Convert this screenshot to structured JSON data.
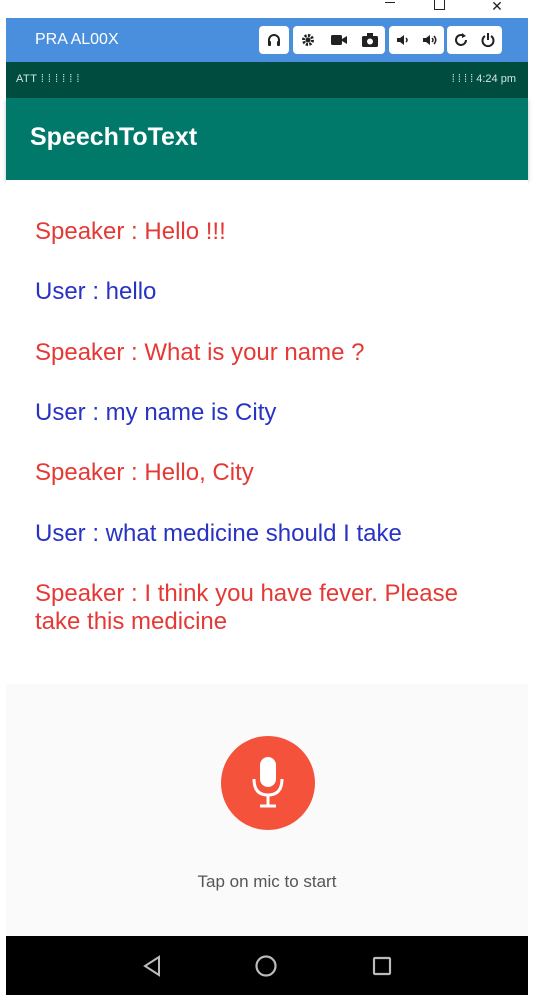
{
  "window": {
    "minimize_icon": "minimize-icon",
    "maximize_icon": "maximize-icon",
    "close_glyph": "✕"
  },
  "emulator": {
    "device_name": "PRA AL00X",
    "controls": [
      "headphones-icon",
      "gear-icon",
      "video-camera-icon",
      "camera-icon",
      "volume-down-icon",
      "volume-up-icon",
      "rotate-icon",
      "power-icon"
    ]
  },
  "status_bar": {
    "left": "ATT  ⁞ ⁞ ⁞ ⁞ ⁞ ⁞",
    "right": "⁞ ⁞ ⁞ ⁞ 4:24 pm"
  },
  "app": {
    "title": "SpeechToText"
  },
  "messages": [
    {
      "role": "speaker",
      "text": "Speaker : Hello !!!"
    },
    {
      "role": "user",
      "text": "User : hello"
    },
    {
      "role": "speaker",
      "text": "Speaker : What is your name ?"
    },
    {
      "role": "user",
      "text": "User : my name is City"
    },
    {
      "role": "speaker",
      "text": "Speaker : Hello, City"
    },
    {
      "role": "user",
      "text": "User : what medicine should I take"
    },
    {
      "role": "speaker",
      "text": "Speaker : I think you have fever. Please"
    },
    {
      "role": "speaker",
      "text": "take this medicine"
    }
  ],
  "mic": {
    "hint": "Tap on mic to start"
  },
  "colors": {
    "appbar": "#00796b",
    "status_bar": "#004d40",
    "speaker": "#e53935",
    "user": "#2833c4",
    "mic": "#f4523b",
    "emulator_bar": "#4a8fde"
  }
}
